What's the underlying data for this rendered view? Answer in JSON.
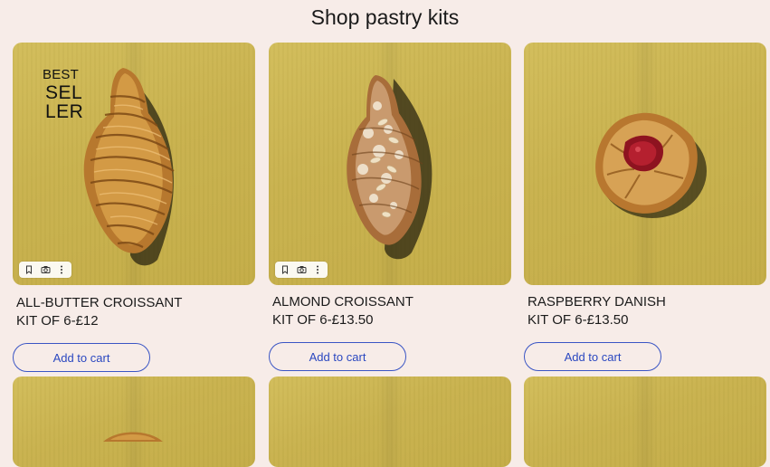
{
  "page": {
    "title": "Shop pastry kits"
  },
  "products": [
    {
      "name": "All-Butter Croissant",
      "price": "KIT OF 6-£12",
      "button": "Add to cart",
      "badge": [
        "BEST",
        "SEL",
        "LER"
      ]
    },
    {
      "name": "Almond Croissant",
      "price": "KIT OF 6-£13.50",
      "button": "Add to cart"
    },
    {
      "name": "Raspberry Danish",
      "price": "KIT OF 6-£13.50",
      "button": "Add to cart"
    }
  ],
  "image_tools": {
    "icons": [
      "bookmark-icon",
      "camera-icon",
      "more-vertical-icon"
    ]
  },
  "colors": {
    "background": "#f7ece8",
    "mustard_cloth": "#c9b24e",
    "button_accent": "#2b48c0"
  }
}
